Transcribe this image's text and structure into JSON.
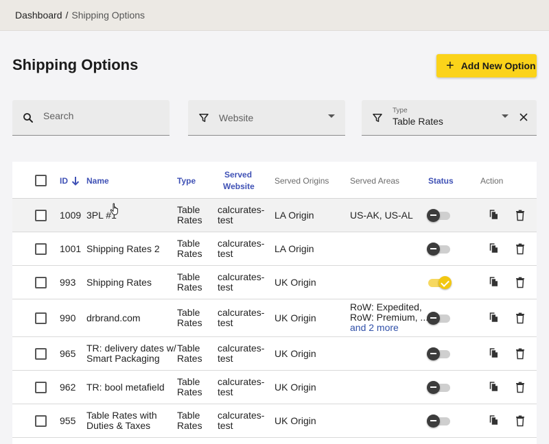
{
  "breadcrumb": {
    "root": "Dashboard",
    "separator": "/",
    "current": "Shipping Options"
  },
  "page": {
    "title": "Shipping Options",
    "add_button_label": "Add New Option",
    "add_button_icon": "plus-icon"
  },
  "filters": {
    "search": {
      "placeholder": "Search",
      "icon": "search-icon"
    },
    "website": {
      "placeholder": "Website",
      "icon": "filter-icon"
    },
    "type": {
      "label": "Type",
      "value": "Table Rates",
      "icon": "filter-icon",
      "clear_icon": "close-icon"
    }
  },
  "table": {
    "headers": {
      "id": "ID",
      "name": "Name",
      "type": "Type",
      "served_website_1": "Served",
      "served_website_2": "Website",
      "served_origins": "Served Origins",
      "served_areas": "Served Areas",
      "status": "Status",
      "action": "Action"
    },
    "sort": {
      "column": "id",
      "direction": "desc",
      "icon": "arrow-down-icon"
    },
    "rows": [
      {
        "id": "1009",
        "name_1": "3PL #1",
        "name_2": "",
        "type_1": "Table",
        "type_2": "Rates",
        "website_1": "calcurates-",
        "website_2": "test",
        "origin": "LA Origin",
        "areas_1": "US-AK, US-AL",
        "areas_2": "",
        "areas_more": "",
        "status": "off"
      },
      {
        "id": "1001",
        "name_1": "Shipping Rates 2",
        "name_2": "",
        "type_1": "Table",
        "type_2": "Rates",
        "website_1": "calcurates-",
        "website_2": "test",
        "origin": "LA Origin",
        "areas_1": "",
        "areas_2": "",
        "areas_more": "",
        "status": "off"
      },
      {
        "id": "993",
        "name_1": "Shipping Rates",
        "name_2": "",
        "type_1": "Table",
        "type_2": "Rates",
        "website_1": "calcurates-",
        "website_2": "test",
        "origin": "UK Origin",
        "areas_1": "",
        "areas_2": "",
        "areas_more": "",
        "status": "on"
      },
      {
        "id": "990",
        "name_1": "drbrand.com",
        "name_2": "",
        "type_1": "Table",
        "type_2": "Rates",
        "website_1": "calcurates-",
        "website_2": "test",
        "origin": "UK Origin",
        "areas_1": "RoW: Expedited,",
        "areas_2": "RoW: Premium, ...",
        "areas_more": "and 2 more",
        "status": "off"
      },
      {
        "id": "965",
        "name_1": "TR: delivery dates w/",
        "name_2": "Smart Packaging",
        "type_1": "Table",
        "type_2": "Rates",
        "website_1": "calcurates-",
        "website_2": "test",
        "origin": "UK Origin",
        "areas_1": "",
        "areas_2": "",
        "areas_more": "",
        "status": "off"
      },
      {
        "id": "962",
        "name_1": "TR: bool metafield",
        "name_2": "",
        "type_1": "Table",
        "type_2": "Rates",
        "website_1": "calcurates-",
        "website_2": "test",
        "origin": "UK Origin",
        "areas_1": "",
        "areas_2": "",
        "areas_more": "",
        "status": "off"
      },
      {
        "id": "955",
        "name_1": "Table Rates with",
        "name_2": "Duties & Taxes",
        "type_1": "Table",
        "type_2": "Rates",
        "website_1": "calcurates-",
        "website_2": "test",
        "origin": "UK Origin",
        "areas_1": "",
        "areas_2": "",
        "areas_more": "",
        "status": "off"
      }
    ],
    "action_icons": [
      "copy-icon",
      "delete-icon"
    ]
  },
  "colors": {
    "accent": "#fbd31a",
    "header_link": "#3f51b5",
    "topbar": "#ece9e4",
    "toggle_on": "#f2c712"
  }
}
